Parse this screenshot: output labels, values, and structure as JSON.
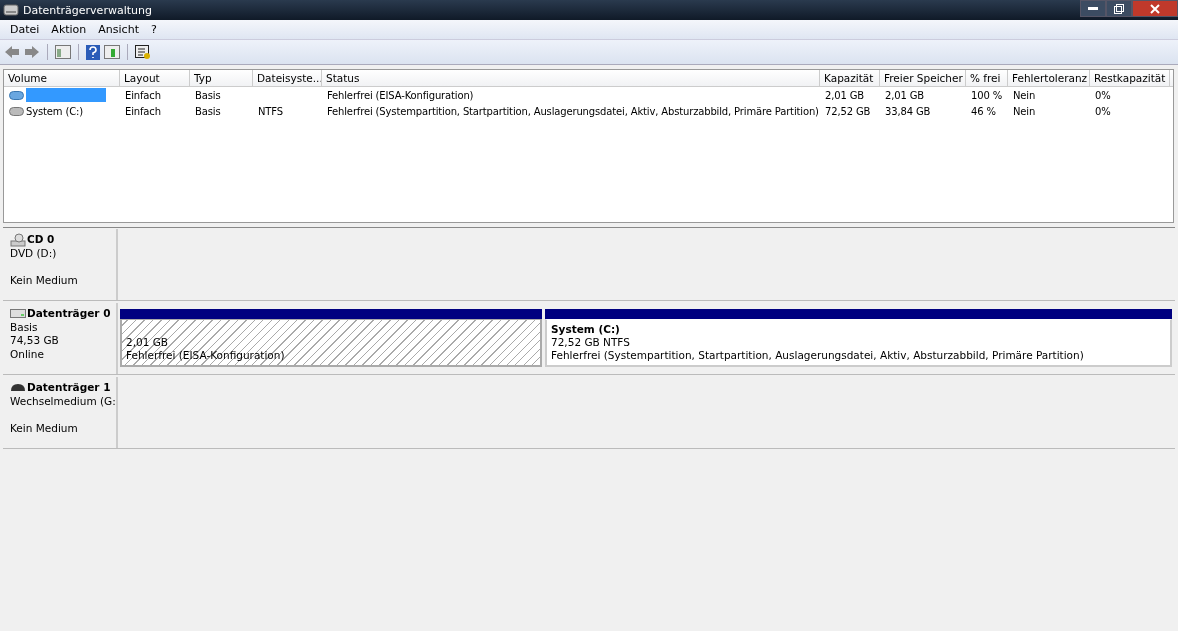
{
  "window": {
    "title": "Datenträgerverwaltung"
  },
  "menu": [
    "Datei",
    "Aktion",
    "Ansicht",
    "?"
  ],
  "table": {
    "columns": [
      "Volume",
      "Layout",
      "Typ",
      "Dateisyste...",
      "Status",
      "Kapazität",
      "Freier Speicher",
      "% frei",
      "Fehlertoleranz",
      "Restkapazität"
    ],
    "rows": [
      {
        "selected": true,
        "kind": "blue",
        "cells": [
          null,
          "Einfach",
          "Basis",
          null,
          "Fehlerfrei (EISA-Konfiguration)",
          "2,01 GB",
          "2,01 GB",
          "100 %",
          "Nein",
          "0%"
        ]
      },
      {
        "selected": false,
        "kind": "gray",
        "cells": [
          "System (C:)",
          "Einfach",
          "Basis",
          "NTFS",
          "Fehlerfrei (Systempartition, Startpartition, Auslagerungsdatei, Aktiv, Absturzabbild, Primäre Partition)",
          "72,52 GB",
          "33,84 GB",
          "46 %",
          "Nein",
          "0%"
        ]
      }
    ]
  },
  "disks": [
    {
      "kind": "cd",
      "name": "CD 0",
      "lines": [
        "DVD (D:)"
      ],
      "note": "Kein Medium"
    },
    {
      "kind": "disk",
      "name": "Datenträger 0",
      "lines": [
        "Basis",
        "74,53 GB",
        "Online"
      ],
      "partitions": [
        {
          "kind": "hatched",
          "size": "2,01 GB",
          "status": "Fehlerfrei (EISA-Konfiguration)"
        },
        {
          "kind": "plain",
          "title": "System  (C:)",
          "size": "72,52 GB NTFS",
          "status": "Fehlerfrei (Systempartition, Startpartition, Auslagerungsdatei, Aktiv, Absturzabbild, Primäre Partition)"
        }
      ]
    },
    {
      "kind": "removable",
      "name": "Datenträger 1",
      "lines": [
        "Wechselmedium (G:"
      ],
      "note": "Kein Medium"
    }
  ]
}
